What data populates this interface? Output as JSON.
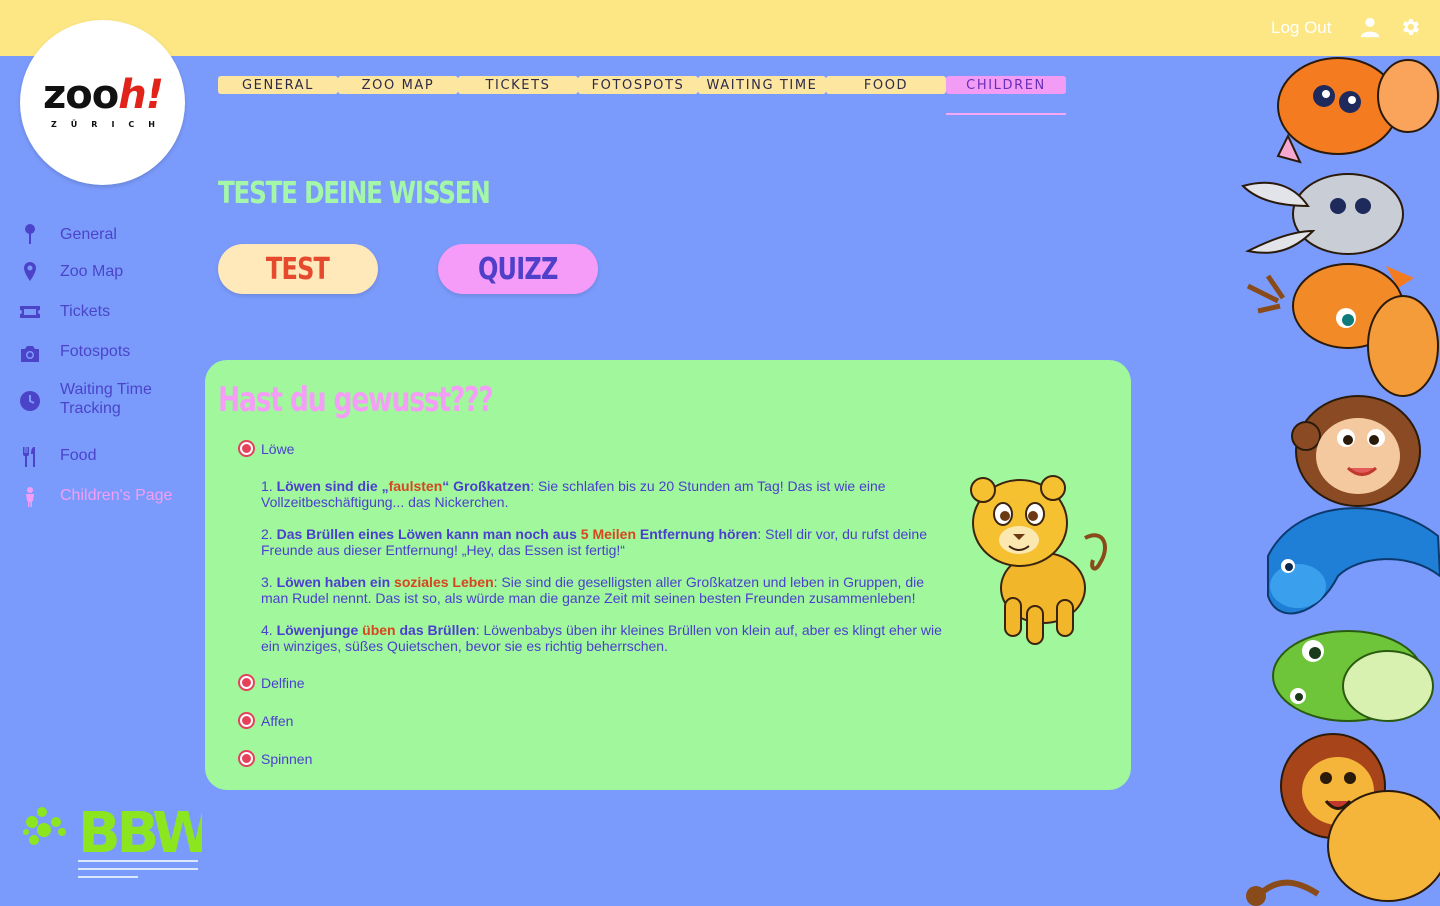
{
  "topbar": {
    "logout": "Log Out"
  },
  "logo": {
    "word_a": "zoo",
    "word_b": "h!",
    "sub": "ZÜRICH"
  },
  "tabs": [
    {
      "label": "GENERAL",
      "active": false
    },
    {
      "label": "ZOO MAP",
      "active": false
    },
    {
      "label": "TICKETS",
      "active": false
    },
    {
      "label": "FOTOSPOTS",
      "active": false
    },
    {
      "label": "WAITING TIME",
      "active": false
    },
    {
      "label": "FOOD",
      "active": false
    },
    {
      "label": "CHILDREN",
      "active": true
    }
  ],
  "sidebar": {
    "items": [
      {
        "label": "General",
        "icon": "pin-icon"
      },
      {
        "label": "Zoo Map",
        "icon": "map-marker-icon"
      },
      {
        "label": "Tickets",
        "icon": "ticket-icon"
      },
      {
        "label": "Fotospots",
        "icon": "camera-icon"
      },
      {
        "label": "Waiting Time Tracking",
        "icon": "clock-icon"
      },
      {
        "label": "Food",
        "icon": "cutlery-icon"
      },
      {
        "label": "Children's Page",
        "icon": "child-icon",
        "active": true
      }
    ]
  },
  "main": {
    "heading": "TESTE DEINE WISSEN",
    "btn_test": "TEST",
    "btn_quizz": "QUIZZ"
  },
  "card": {
    "title": "Hast du gewusst???",
    "options": [
      "Löwe",
      "Delfine",
      "Affen",
      "Spinnen"
    ],
    "facts": {
      "f1": {
        "n": "1. ",
        "b1": "Löwen sind die „",
        "h": "faulsten",
        "b2": "“ Großkatzen",
        "t": ": Sie schlafen bis zu 20 Stunden am Tag! Das ist wie eine Vollzeitbeschäftigung... das Nickerchen."
      },
      "f2": {
        "n": "2. ",
        "b1": "Das Brüllen eines Löwen kann man noch aus ",
        "h": "5 Meilen",
        "b2": " Entfernung hören",
        "t": ": Stell dir vor, du rufst deine Freunde aus dieser Entfernung! „Hey, das Essen ist fertig!“"
      },
      "f3": {
        "n": "3. ",
        "b1": "Löwen haben ein ",
        "h": "soziales Leben",
        "b2": "",
        "t": ": Sie sind die geselligsten aller Großkatzen und leben in Gruppen, die man Rudel nennt. Das ist so, als würde man die ganze Zeit mit seinen besten Freunden zusammenleben!"
      },
      "f4": {
        "n": "4. ",
        "b1": "Löwenjunge ",
        "h": "üben",
        "b2": " das Brüllen",
        "t": ": Löwenbabys üben ihr kleines Brüllen von klein auf, aber es klingt eher wie ein winziges, süßes Quietschen, bevor sie es richtig beherrschen."
      }
    }
  },
  "bbw": {
    "mark": "BBW"
  },
  "colors": {
    "background": "#7b9bfc",
    "topbar": "#fde784",
    "card": "#a0f79c",
    "accent_pink": "#f59ef8",
    "accent_red": "#e6405a",
    "text": "#4b3fcf"
  }
}
